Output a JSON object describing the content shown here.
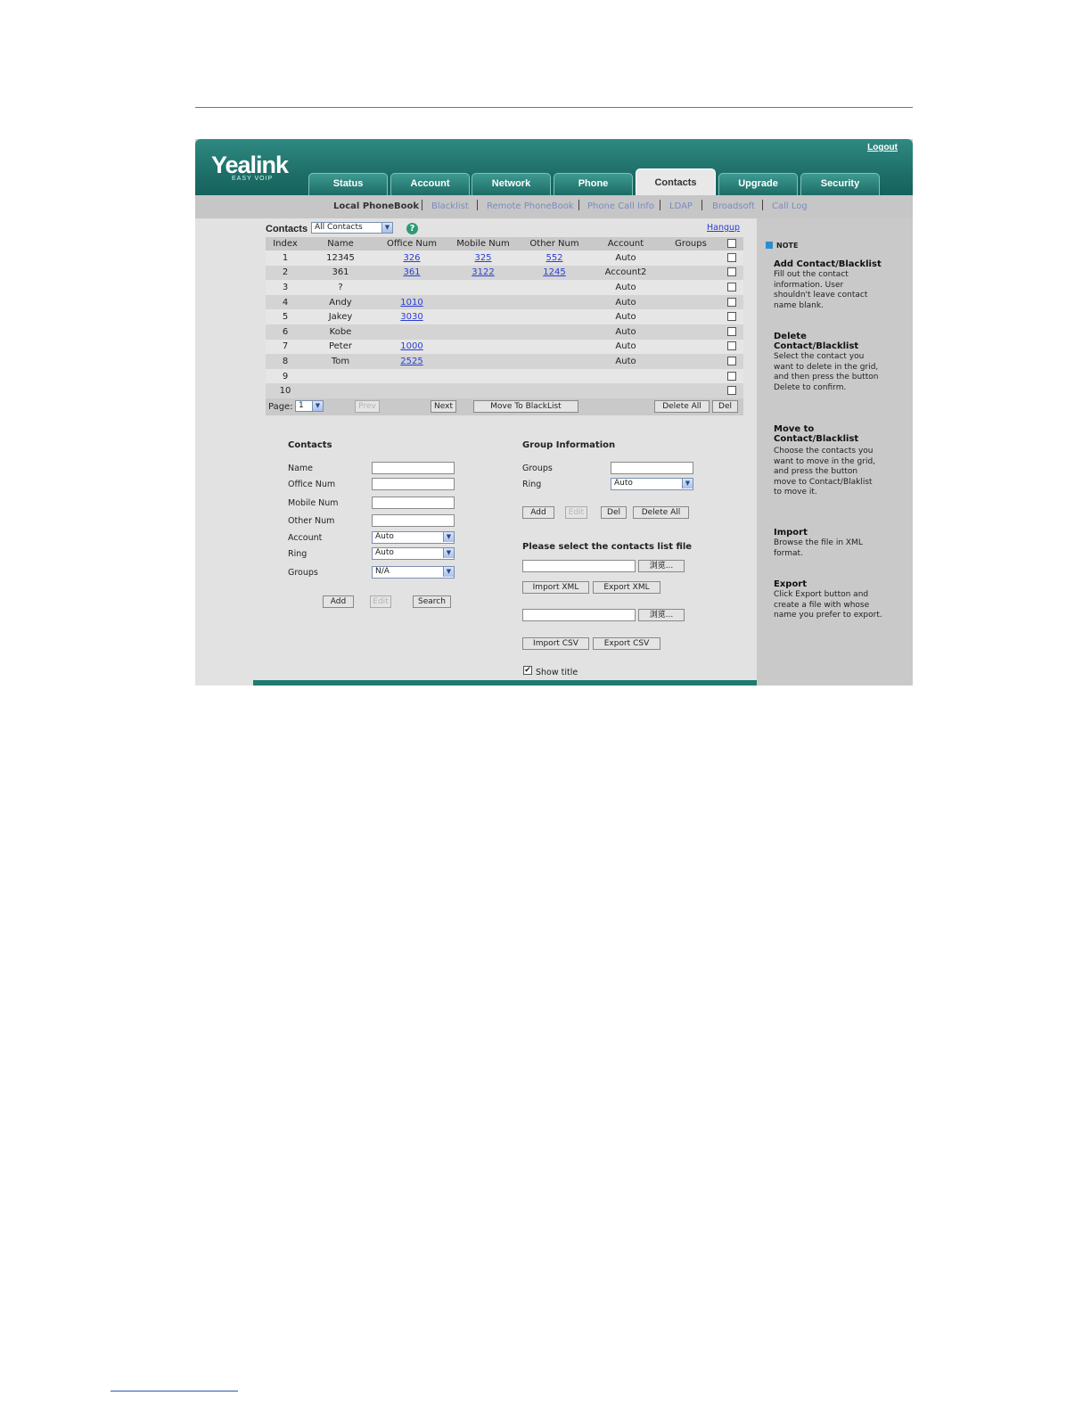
{
  "header": {
    "logo": "Yealink",
    "logo_sub": "EASY VOIP",
    "logout": "Logout",
    "tabs": [
      "Status",
      "Account",
      "Network",
      "Phone",
      "Contacts",
      "Upgrade",
      "Security"
    ],
    "active_tab": "Contacts"
  },
  "subnav": [
    "Local PhoneBook",
    "Blacklist",
    "Remote PhoneBook",
    "Phone Call Info",
    "LDAP",
    "Broadsoft",
    "Call Log"
  ],
  "toolbar": {
    "label": "Contacts",
    "filter_value": "All Contacts",
    "hangup": "Hangup"
  },
  "grid": {
    "columns": [
      "Index",
      "Name",
      "Office Num",
      "Mobile Num",
      "Other Num",
      "Account",
      "Groups"
    ],
    "rows": [
      [
        "1",
        "12345",
        "326",
        "325",
        "552",
        "Auto",
        ""
      ],
      [
        "2",
        "361",
        "361",
        "3122",
        "1245",
        "Account2",
        ""
      ],
      [
        "3",
        "?",
        "",
        "",
        "",
        "Auto",
        ""
      ],
      [
        "4",
        "Andy",
        "1010",
        "",
        "",
        "Auto",
        ""
      ],
      [
        "5",
        "Jakey",
        "3030",
        "",
        "",
        "Auto",
        ""
      ],
      [
        "6",
        "Kobe",
        "",
        "",
        "",
        "Auto",
        ""
      ],
      [
        "7",
        "Peter",
        "1000",
        "",
        "",
        "Auto",
        ""
      ],
      [
        "8",
        "Tom",
        "2525",
        "",
        "",
        "Auto",
        ""
      ],
      [
        "9",
        "",
        "",
        "",
        "",
        "",
        ""
      ],
      [
        "10",
        "",
        "",
        "",
        "",
        "",
        ""
      ]
    ]
  },
  "pager": {
    "label": "Page:",
    "page_value": "1",
    "prev": "Prev",
    "next": "Next",
    "move_blacklist": "Move To BlackList",
    "delete_all": "Delete All",
    "del": "Del"
  },
  "contact_form": {
    "title": "Contacts",
    "name_label": "Name",
    "office_label": "Office Num",
    "mobile_label": "Mobile Num",
    "other_label": "Other Num",
    "account_label": "Account",
    "account_value": "Auto",
    "ring_label": "Ring",
    "ring_value": "Auto",
    "groups_label": "Groups",
    "groups_value": "N/A",
    "add": "Add",
    "edit": "Edit",
    "search": "Search"
  },
  "group_form": {
    "title": "Group Information",
    "groups_label": "Groups",
    "ring_label": "Ring",
    "ring_value": "Auto",
    "add": "Add",
    "edit": "Edit",
    "del": "Del",
    "delete_all": "Delete All"
  },
  "file": {
    "title": "Please select the contacts list file",
    "browse": "浏览...",
    "import_xml": "Import XML",
    "export_xml": "Export XML",
    "import_csv": "Import CSV",
    "export_csv": "Export CSV",
    "show_title": "Show title"
  },
  "note": {
    "head": "NOTE",
    "sections": [
      {
        "title": "Add Contact/Blacklist",
        "body": "Fill out the contact information. User shouldn't leave contact name blank."
      },
      {
        "title": "Delete Contact/Blacklist",
        "body": "Select the contact you want to delete in the grid, and then press the button Delete to confirm."
      },
      {
        "title": "Move to Contact/Blacklist",
        "body": "Choose the contacts you want to move in the grid, and press the button move to Contact/Blaklist to move it."
      },
      {
        "title": "Import",
        "body": "Browse the file in XML format."
      },
      {
        "title": "Export",
        "body": "Click Export button and create a file with whose name you prefer to export."
      }
    ]
  }
}
